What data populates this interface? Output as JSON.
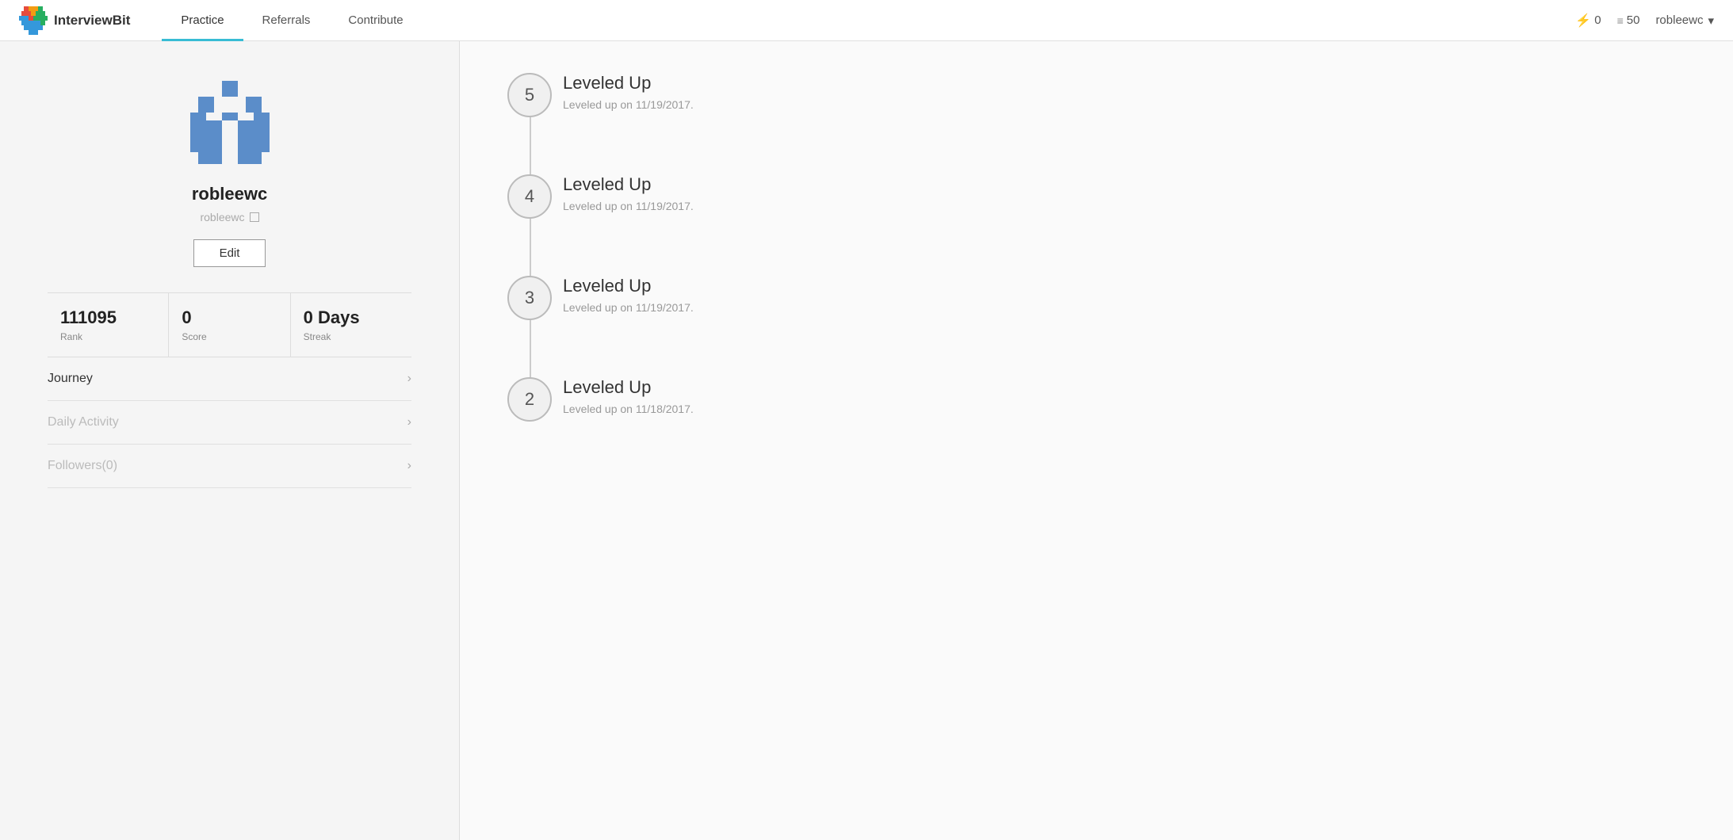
{
  "header": {
    "logo_text": "InterviewBit",
    "nav": [
      {
        "label": "Practice",
        "active": true
      },
      {
        "label": "Referrals",
        "active": false
      },
      {
        "label": "Contribute",
        "active": false
      }
    ],
    "bolt_count": "0",
    "coins_count": "50",
    "username": "robleewc",
    "chevron": "▾"
  },
  "profile": {
    "username": "robleewc",
    "username_sub": "robleewc",
    "edit_label": "Edit",
    "stats": [
      {
        "value": "111095",
        "label": "Rank"
      },
      {
        "value": "0",
        "label": "Score"
      },
      {
        "value": "0 Days",
        "label": "Streak"
      }
    ],
    "menu_items": [
      {
        "label": "Journey",
        "active": true
      },
      {
        "label": "Daily Activity",
        "active": false
      },
      {
        "label": "Followers(0)",
        "active": false
      }
    ]
  },
  "journey": {
    "items": [
      {
        "level": "5",
        "title": "Leveled Up",
        "date": "Leveled up on 11/19/2017."
      },
      {
        "level": "4",
        "title": "Leveled Up",
        "date": "Leveled up on 11/19/2017."
      },
      {
        "level": "3",
        "title": "Leveled Up",
        "date": "Leveled up on 11/19/2017."
      },
      {
        "level": "2",
        "title": "Leveled Up",
        "date": "Leveled up on 11/18/2017."
      }
    ]
  }
}
